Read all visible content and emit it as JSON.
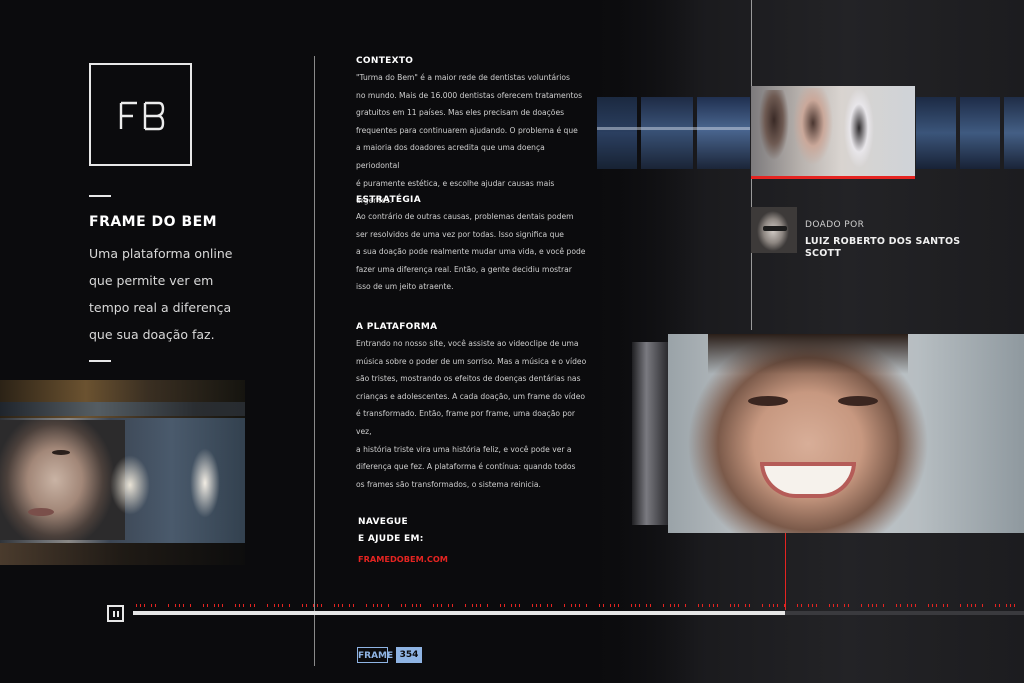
{
  "brand": {
    "logo_text": "FB",
    "title": "FRAME DO BEM",
    "tagline_lines": [
      "Uma plataforma online",
      "que permite ver em",
      "tempo real a diferença",
      "que sua doação faz."
    ]
  },
  "sections": {
    "contexto": {
      "heading": "CONTEXTO",
      "lines": [
        "\"Turma do Bem\" é a maior rede de dentistas voluntários",
        "no mundo. Mais de 16.000 dentistas oferecem tratamentos",
        "gratuitos em 11 países. Mas eles precisam de doações",
        "frequentes para continuarem ajudando. O problema é que",
        "a maioria dos doadores acredita que uma doença periodontal",
        "é puramente estética, e escolhe ajudar causas mais urgentes."
      ]
    },
    "estrategia": {
      "heading": "ESTRATÉGIA",
      "lines": [
        "Ao contrário de outras causas, problemas dentais podem",
        "ser resolvidos de uma vez por todas. Isso significa que",
        "a sua doação pode realmente mudar uma vida, e você pode",
        "fazer uma diferença real. Então, a gente decidiu mostrar",
        "isso de um jeito atraente."
      ]
    },
    "plataforma": {
      "heading": "A PLATAFORMA",
      "lines": [
        "Entrando no nosso site, você assiste ao videoclipe de uma",
        "música sobre o poder de um sorriso. Mas a música e o vídeo",
        "são tristes, mostrando os efeitos de doenças dentárias nas",
        "crianças e adolescentes. A cada doação, um frame do vídeo",
        "é transformado. Então, frame por frame, uma doação por vez,",
        "a história triste vira uma história feliz, e você pode ver a",
        "diferença que fez. A plataforma é contínua: quando todos",
        "os frames são transformados, o sistema reinicia."
      ]
    }
  },
  "cta": {
    "line1": "NAVEGUE",
    "line2": "E AJUDE EM:",
    "link": "FRAMEDOBEM.COM"
  },
  "donor": {
    "label": "DOADO POR",
    "name_line1": "LUIZ ROBERTO DOS SANTOS",
    "name_line2": "SCOTT"
  },
  "frame_counter": {
    "label": "FRAME",
    "number": "354"
  },
  "colors": {
    "accent_red": "#e52421",
    "background": "#0b0b0d",
    "badge_blue": "#8fb4e3"
  },
  "icons": {
    "pause": "pause-icon"
  }
}
